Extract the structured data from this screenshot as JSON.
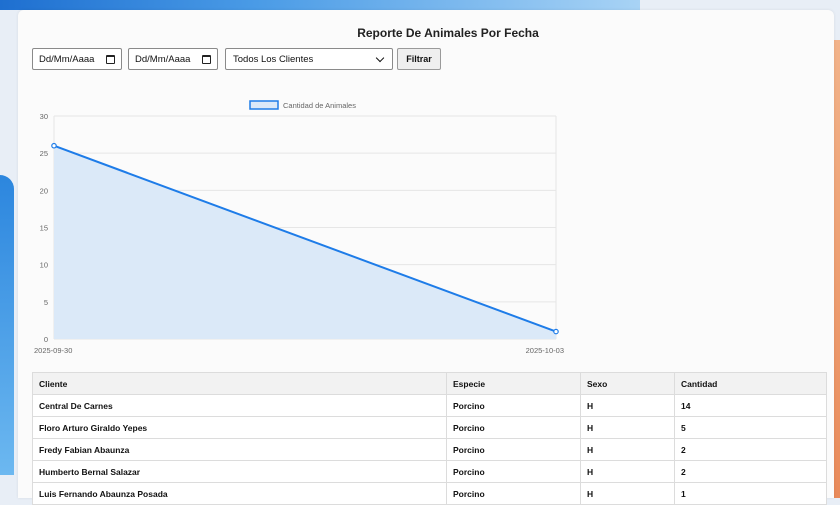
{
  "report": {
    "title": "Reporte De Animales Por Fecha"
  },
  "filters": {
    "date_from_placeholder": "Dd/Mm/Aaaa",
    "date_to_placeholder": "Dd/Mm/Aaaa",
    "client_select_value": "Todos Los Clientes",
    "filter_button": "Filtrar"
  },
  "chart_data": {
    "type": "area",
    "x": [
      "2025-09-30",
      "2025-10-03"
    ],
    "series": [
      {
        "name": "Cantidad de Animales",
        "values": [
          26,
          1
        ]
      }
    ],
    "y_ticks": [
      0,
      5,
      10,
      15,
      20,
      25,
      30
    ],
    "ylim": [
      0,
      30
    ],
    "grid": true,
    "legend": "top-center",
    "colors": {
      "line": "#1e7ce8",
      "fill": "#dbe9f8"
    }
  },
  "table": {
    "headers": [
      "Cliente",
      "Especie",
      "Sexo",
      "Cantidad"
    ],
    "rows": [
      [
        "Central De Carnes",
        "Porcino",
        "H",
        "14"
      ],
      [
        "Floro Arturo Giraldo Yepes",
        "Porcino",
        "H",
        "5"
      ],
      [
        "Fredy Fabian Abaunza",
        "Porcino",
        "H",
        "2"
      ],
      [
        "Humberto Bernal Salazar",
        "Porcino",
        "H",
        "2"
      ],
      [
        "Luis Fernando Abaunza Posada",
        "Porcino",
        "H",
        "1"
      ]
    ]
  }
}
